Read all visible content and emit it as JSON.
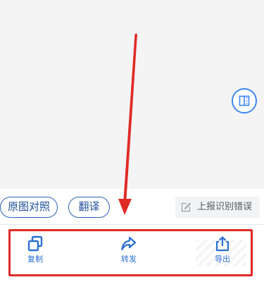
{
  "result_panel": {
    "compare_button_label": "原图对照",
    "translate_button_label": "翻译",
    "report_error_label": "上报识别错误"
  },
  "toolbar": {
    "copy_label": "复制",
    "share_label": "转发",
    "export_label": "导出"
  },
  "colors": {
    "accent_blue": "#2b6fd6",
    "pill_border": "#2a62b8",
    "highlight_red": "#e02a26"
  },
  "icons": {
    "compare_toggle": "split-view-icon",
    "report": "edit-note-icon",
    "copy": "copy-icon",
    "share": "forward-arrow-icon",
    "export": "export-upload-icon"
  }
}
